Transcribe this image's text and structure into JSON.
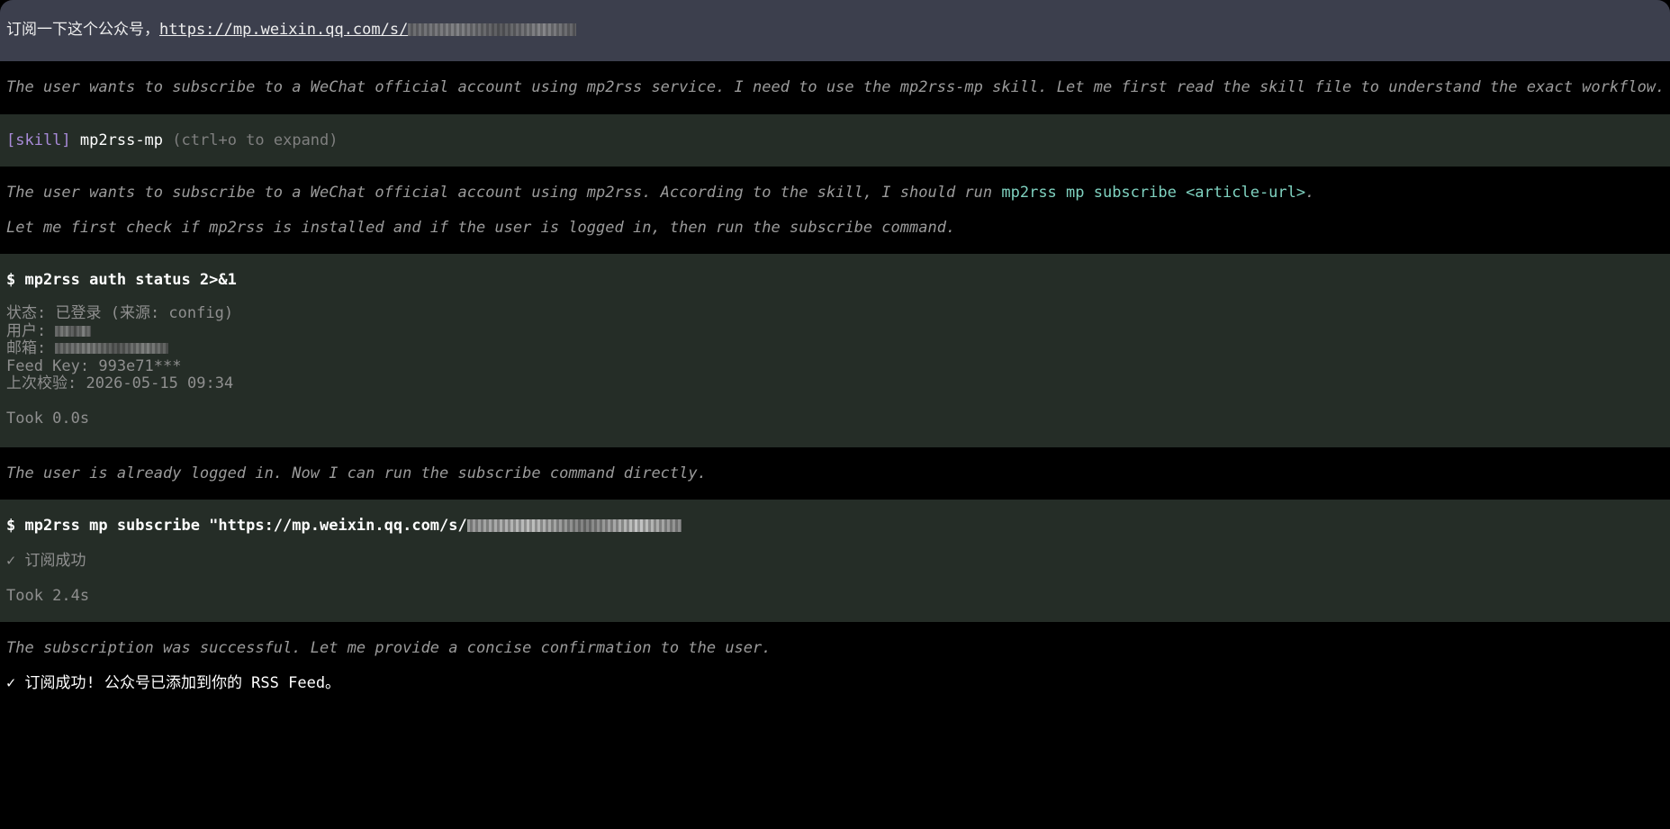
{
  "user_message": {
    "prefix": "订阅一下这个公众号，",
    "url": "https://mp.weixin.qq.com/s/"
  },
  "thinking_1": "The user wants to subscribe to a WeChat official account using mp2rss service. I need to use the mp2rss-mp skill. Let me first read the skill file to understand the exact workflow.",
  "skill": {
    "tag": "[skill]",
    "name": "mp2rss-mp",
    "hint": "(ctrl+o to expand)"
  },
  "thinking_2": {
    "line1_prefix": "The user wants to subscribe to a WeChat official account using mp2rss. According to the skill, I should run ",
    "line1_code": "mp2rss mp subscribe <article-url>",
    "line1_suffix": ".",
    "line2": "Let me first check if mp2rss is installed and if the user is logged in, then run the subscribe command."
  },
  "tool_1": {
    "command": "$ mp2rss auth status 2>&1",
    "status_line": "状态: 已登录 (来源: config)",
    "user_label": "用户: ",
    "email_label": "邮箱: ",
    "feed_key": "Feed Key: 993e71***",
    "last_verified": "上次校验: 2026-05-15 09:34",
    "took": "Took 0.0s"
  },
  "thinking_3": "The user is already logged in. Now I can run the subscribe command directly.",
  "tool_2": {
    "command": "$ mp2rss mp subscribe \"https://mp.weixin.qq.com/s/",
    "result": "✓ 订阅成功",
    "took": "Took 2.4s"
  },
  "thinking_4": "The subscription was successful. Let me provide a concise confirmation to the user.",
  "final_message": "✓ 订阅成功! 公众号已添加到你的 RSS Feed。",
  "colors": {
    "user_bg": "#3c3f4d",
    "tool_bg": "#252d27",
    "code": "#7fd2c0",
    "skill_tag": "#a98bd9"
  }
}
